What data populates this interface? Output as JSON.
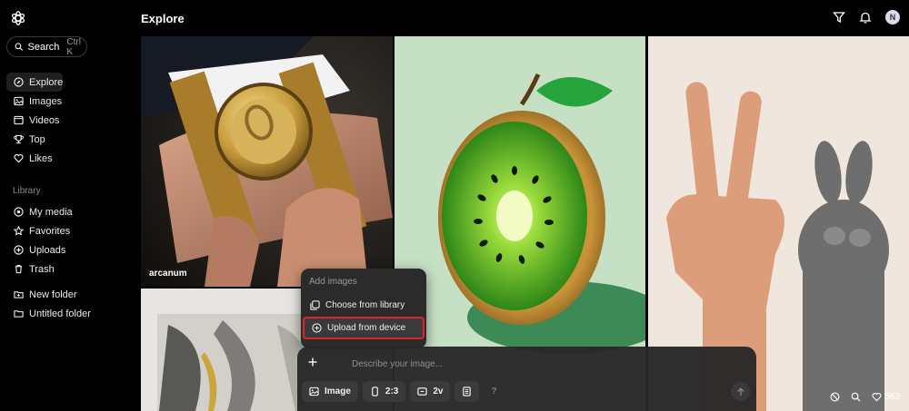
{
  "sidebar": {
    "search": {
      "label": "Search",
      "shortcut": "Ctrl K"
    },
    "main_nav": [
      {
        "label": "Explore",
        "icon": "compass-icon",
        "active": true
      },
      {
        "label": "Images",
        "icon": "image-icon"
      },
      {
        "label": "Videos",
        "icon": "video-icon"
      },
      {
        "label": "Top",
        "icon": "trophy-icon"
      },
      {
        "label": "Likes",
        "icon": "heart-icon"
      }
    ],
    "library_label": "Library",
    "library_nav": [
      {
        "label": "My media",
        "icon": "media-icon"
      },
      {
        "label": "Favorites",
        "icon": "star-icon"
      },
      {
        "label": "Uploads",
        "icon": "upload-icon"
      },
      {
        "label": "Trash",
        "icon": "trash-icon"
      }
    ],
    "folders": [
      {
        "label": "New folder",
        "icon": "folder-plus-icon"
      },
      {
        "label": "Untitled folder",
        "icon": "folder-icon"
      }
    ]
  },
  "header": {
    "title": "Explore",
    "avatar_initial": "N"
  },
  "tiles": {
    "first_caption": "arcanum"
  },
  "popover": {
    "heading": "Add images",
    "items": [
      {
        "label": "Choose from library"
      },
      {
        "label": "Upload from device"
      }
    ]
  },
  "composer": {
    "placeholder": "Describe your image...",
    "mode_label": "Image",
    "aspect_label": "2:3",
    "variants_label": "2v",
    "help_label": "?"
  },
  "tile_actions": {
    "likes_count": "563"
  },
  "colors": {
    "highlight_border": "#e2232a",
    "background": "#000000"
  }
}
